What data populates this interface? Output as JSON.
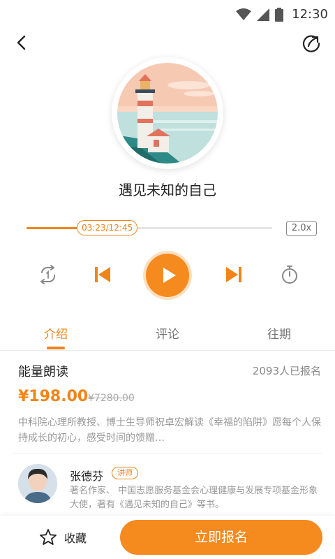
{
  "status_bar": {
    "time": "12:30",
    "icons": [
      "wifi-icon",
      "signal-icon",
      "battery-icon"
    ]
  },
  "nav": {
    "back_icon": "back-arrow-icon",
    "share_icon": "share-icon"
  },
  "player": {
    "title": "遇见未知的自己",
    "time_display": "03:23/12:45",
    "progress": 0.265,
    "speed": "2.0x",
    "controls": [
      "repeat-one-icon",
      "previous-icon",
      "play-icon",
      "next-icon",
      "timer-icon"
    ]
  },
  "tabs": [
    {
      "label": "介绍",
      "active": true
    },
    {
      "label": "评论",
      "active": false
    },
    {
      "label": "往期",
      "active": false
    }
  ],
  "course": {
    "name": "能量朗读",
    "enrolled": "2093人已报名",
    "price": "¥198.00",
    "original_price": "¥7280.00",
    "description": "中科院心理所教授、博士生导师祝卓宏解读《幸福的陷阱》愿每个人保持成长的初心，感受时间的馈赠…"
  },
  "teacher": {
    "name": "张德芬",
    "badge": "讲师",
    "bio": "著名作家、 中国志愿服务基金会心理健康与发展专项基金形象大使，著有《遇见未知的自己》等书。"
  },
  "bottom": {
    "favorite_label": "收藏",
    "signup_label": "立即报名"
  },
  "colors": {
    "accent": "#f08519",
    "accent_light": "#fde0c2"
  }
}
